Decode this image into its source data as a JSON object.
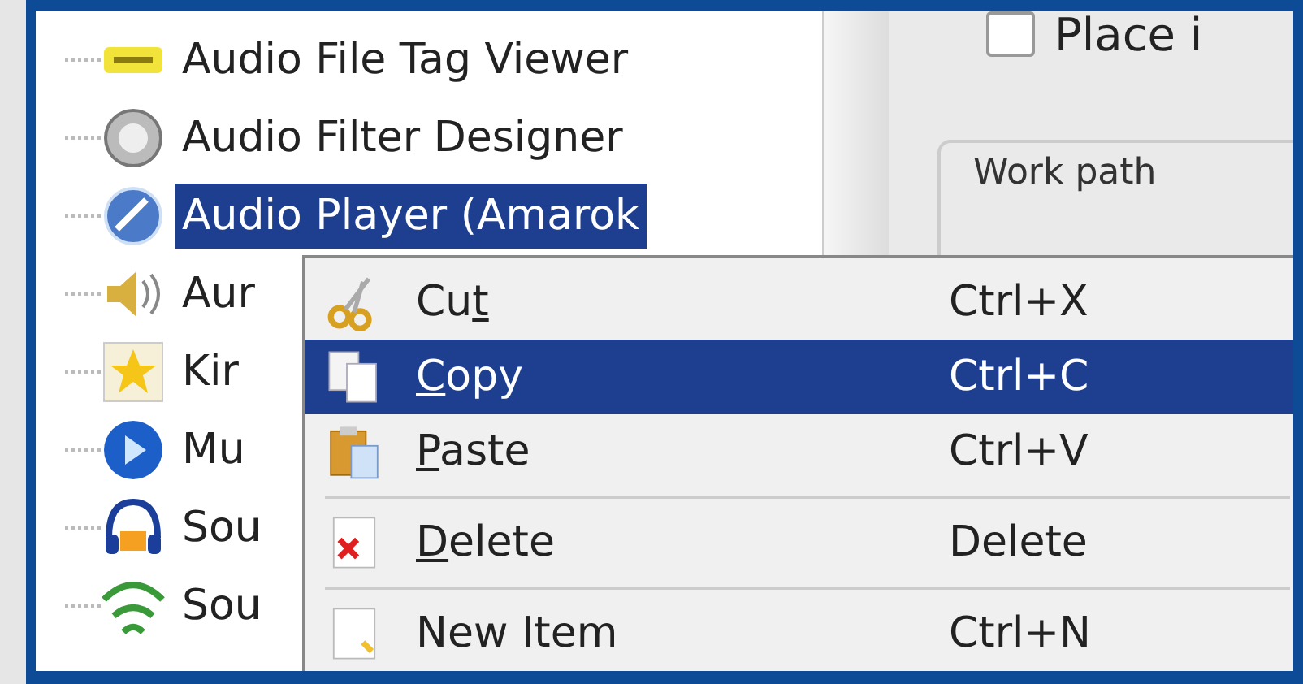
{
  "tree": {
    "items": [
      {
        "label": "Audio File Tag Viewer",
        "selected": false
      },
      {
        "label": "Audio Filter Designer",
        "selected": false
      },
      {
        "label": "Audio Player (Amarok",
        "selected": true
      },
      {
        "label": "Aur",
        "selected": false
      },
      {
        "label": "Kir",
        "selected": false
      },
      {
        "label": "Mu",
        "selected": false
      },
      {
        "label": "Sou",
        "selected": false
      },
      {
        "label": "Sou",
        "selected": false
      }
    ]
  },
  "options": {
    "checkbox": {
      "label": "Place i",
      "checked": false
    },
    "group_label": "Work path"
  },
  "context_menu": {
    "entries": [
      {
        "kind": "item",
        "before": "Cu",
        "mnemonic": "t",
        "shortcut": "Ctrl+X",
        "selected": false
      },
      {
        "kind": "item",
        "mnemonic": "C",
        "after": "opy",
        "shortcut": "Ctrl+C",
        "selected": true
      },
      {
        "kind": "item",
        "mnemonic": "P",
        "after": "aste",
        "shortcut": "Ctrl+V",
        "selected": false
      },
      {
        "kind": "separator"
      },
      {
        "kind": "item",
        "mnemonic": "D",
        "after": "elete",
        "shortcut": "Delete",
        "selected": false
      },
      {
        "kind": "separator"
      },
      {
        "kind": "item",
        "before": "New Item",
        "shortcut": "Ctrl+N",
        "selected": false
      }
    ]
  }
}
